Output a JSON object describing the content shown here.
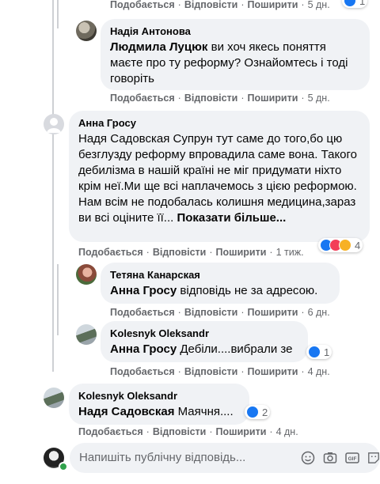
{
  "actions": {
    "like": "Подобається",
    "reply": "Відповісти",
    "share": "Поширити"
  },
  "top_partial": {
    "time": "5 дн."
  },
  "comments": [
    {
      "author": "Надія Антонова",
      "mention": "Людмила Луцюк",
      "text": "ви хоч якесь поняття маєте про ту реформу? Ознайомтесь і тоді говоріть",
      "time": "5 дн."
    },
    {
      "author": "Анна Гросу",
      "text": "Надя Садовская Супрун тут саме до того,бо цю безглузду реформу впровадила саме вона. Такого дебилізма в нашій країні не міг придумати ніхто крім неї.Ми ще всі наплачемось з цією реформою. Нам всім не подобалась колишня медицина,зараз ви всі оціните її...",
      "more": "Показати більше...",
      "time": "1 тиж.",
      "reactions": "4"
    },
    {
      "author": "Тетяна Канарская",
      "mention": "Анна Гросу",
      "text": "відповідь не за адресою.",
      "time": "6 дн."
    },
    {
      "author": "Kolesnyk Oleksandr",
      "mention": "Анна Гросу",
      "text": "Дебіли....вибрали зе",
      "time": "4 дн.",
      "reactions": "1"
    },
    {
      "author": "Kolesnyk Oleksandr",
      "mention": "Надя Садовская",
      "text": "Маячня....",
      "time": "4 дн.",
      "reactions": "2"
    }
  ],
  "reply": {
    "placeholder": "Напишіть публічну відповідь..."
  },
  "icons": [
    "like-icon",
    "love-icon",
    "haha-icon",
    "emoji-icon",
    "camera-icon",
    "gif-icon",
    "sticker-icon"
  ],
  "colors": {
    "bubble": "#f0f2f5",
    "meta": "#65676b",
    "like": "#1877f2",
    "love": "#f33e58",
    "haha": "#f7b125"
  }
}
